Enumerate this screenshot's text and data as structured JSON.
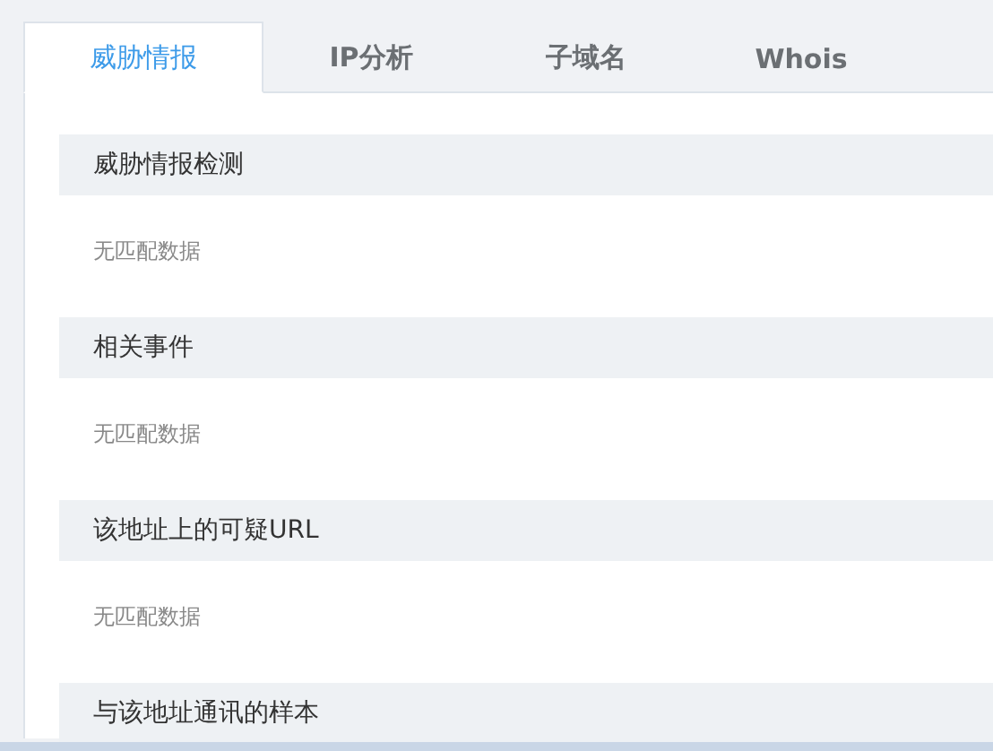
{
  "tabs": [
    {
      "label": "威胁情报",
      "selected": true
    },
    {
      "label": "IP分析",
      "selected": false
    },
    {
      "label": "子域名",
      "selected": false
    },
    {
      "label": "Whois",
      "selected": false
    }
  ],
  "sections": [
    {
      "title": "威胁情报检测",
      "empty_text": "无匹配数据"
    },
    {
      "title": "相关事件",
      "empty_text": "无匹配数据"
    },
    {
      "title": "该地址上的可疑URL",
      "empty_text": "无匹配数据"
    },
    {
      "title": "与该地址通讯的样本"
    }
  ]
}
